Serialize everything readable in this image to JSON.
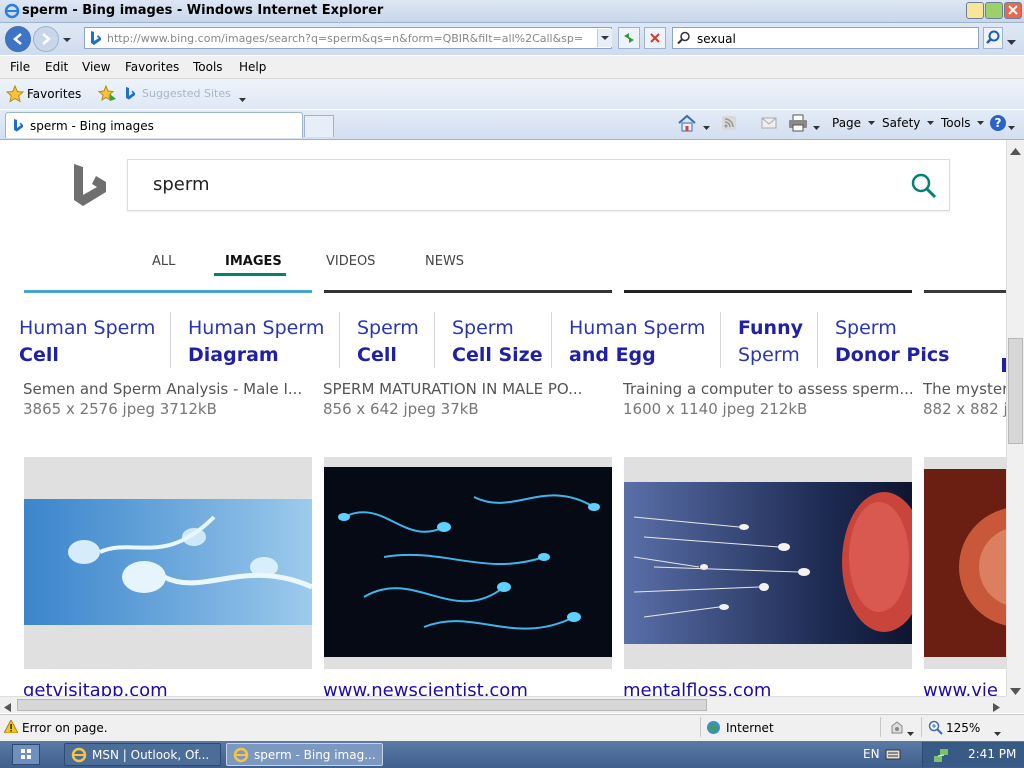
{
  "window": {
    "title": "sperm - Bing images - Windows Internet Explorer"
  },
  "address": {
    "url": "http://www.bing.com/images/search?q=sperm&qs=n&form=QBIR&filt=all%2Call&sp="
  },
  "search_box": {
    "value": "sexual"
  },
  "menu": [
    "File",
    "Edit",
    "View",
    "Favorites",
    "Tools",
    "Help"
  ],
  "favorites": {
    "label": "Favorites",
    "suggested": "Suggested Sites"
  },
  "tab": {
    "label": "sperm - Bing images"
  },
  "commands": {
    "page": "Page",
    "safety": "Safety",
    "tools": "Tools"
  },
  "bing": {
    "query": "sperm",
    "nav": [
      "ALL",
      "IMAGES",
      "VIDEOS",
      "NEWS"
    ],
    "related": [
      {
        "l1": "Human Sperm",
        "l2": "Cell"
      },
      {
        "l1": "Human Sperm",
        "l2": "Diagram"
      },
      {
        "l1": "Sperm",
        "l2": "Cell"
      },
      {
        "l1": "Sperm",
        "l2": "Cell Size"
      },
      {
        "l1": "Human Sperm",
        "l2": "and Egg"
      },
      {
        "l1": "Funny",
        "l2": "Sperm"
      },
      {
        "l1": "Sperm",
        "l2": "Donor Pics"
      }
    ],
    "results_row1": [
      {
        "title": "Semen and Sperm Analysis - Male I...",
        "dims": "3865 x 2576 jpeg 3712kB"
      },
      {
        "title": "SPERM MATURATION IN MALE PO...",
        "dims": "856 x 642 jpeg 37kB"
      },
      {
        "title": "Training a computer to assess sperm...",
        "dims": "1600 x 1140 jpeg 212kB"
      },
      {
        "title": "The myster",
        "dims": "882 x 882 jp"
      }
    ],
    "results_row2": [
      {
        "source": "getvisitapp.com"
      },
      {
        "source": "www.newscientist.com"
      },
      {
        "source": "mentalfloss.com"
      },
      {
        "source": "www.vie"
      }
    ]
  },
  "status": {
    "text": "Error on page.",
    "zone": "Internet",
    "zoom": "125%"
  },
  "taskbar": {
    "items": [
      "MSN | Outlook, Of...",
      "sperm - Bing imag..."
    ],
    "lang": "EN",
    "time": "2:41 PM"
  },
  "colors": {
    "bing_teal": "#008373",
    "link_blue": "#1a0dab"
  }
}
